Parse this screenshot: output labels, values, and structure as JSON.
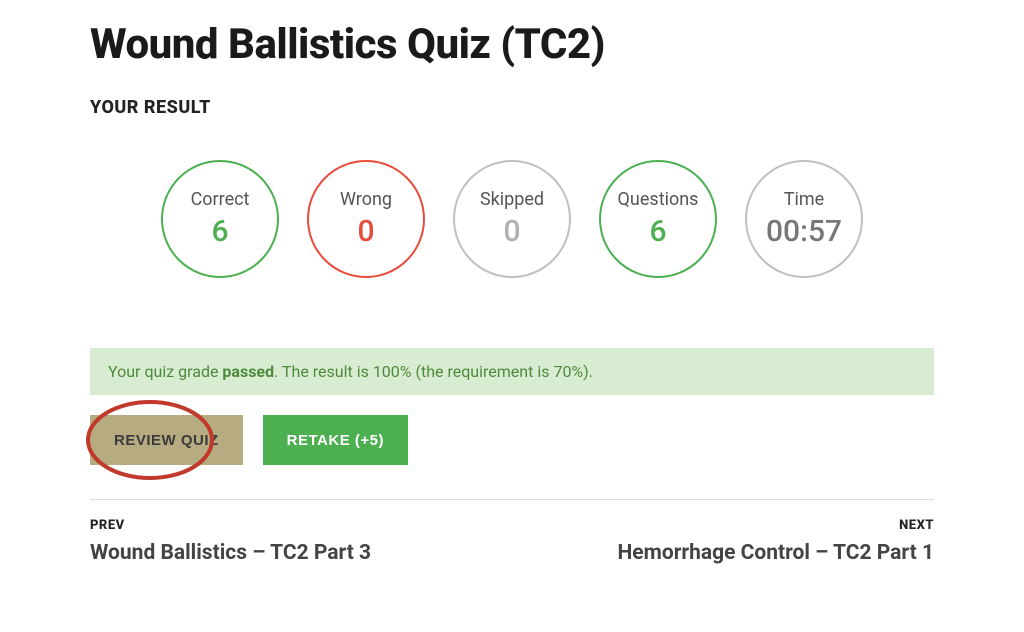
{
  "title": "Wound Ballistics Quiz (TC2)",
  "result_heading": "YOUR RESULT",
  "stats": {
    "correct": {
      "label": "Correct",
      "value": "6"
    },
    "wrong": {
      "label": "Wrong",
      "value": "0"
    },
    "skipped": {
      "label": "Skipped",
      "value": "0"
    },
    "questions": {
      "label": "Questions",
      "value": "6"
    },
    "time": {
      "label": "Time",
      "value": "00:57"
    }
  },
  "grade": {
    "prefix": "Your quiz grade ",
    "status": "passed",
    "suffix": ". The result is 100% (the requirement is 70%)."
  },
  "buttons": {
    "review": "REVIEW QUIZ",
    "retake": "RETAKE (+5)"
  },
  "nav": {
    "prev_label": "PREV",
    "prev_title": "Wound Ballistics – TC2 Part 3",
    "next_label": "NEXT",
    "next_title": "Hemorrhage Control – TC2 Part 1"
  },
  "colors": {
    "correct": "#4caf50",
    "wrong": "#e74c3c",
    "neutral": "#b0b0b0",
    "grade_bg": "#d8ecd2",
    "grade_text": "#4e8a3b",
    "review_btn": "#b7ab82",
    "retake_btn": "#4caf50",
    "annotation": "#c0392b"
  }
}
